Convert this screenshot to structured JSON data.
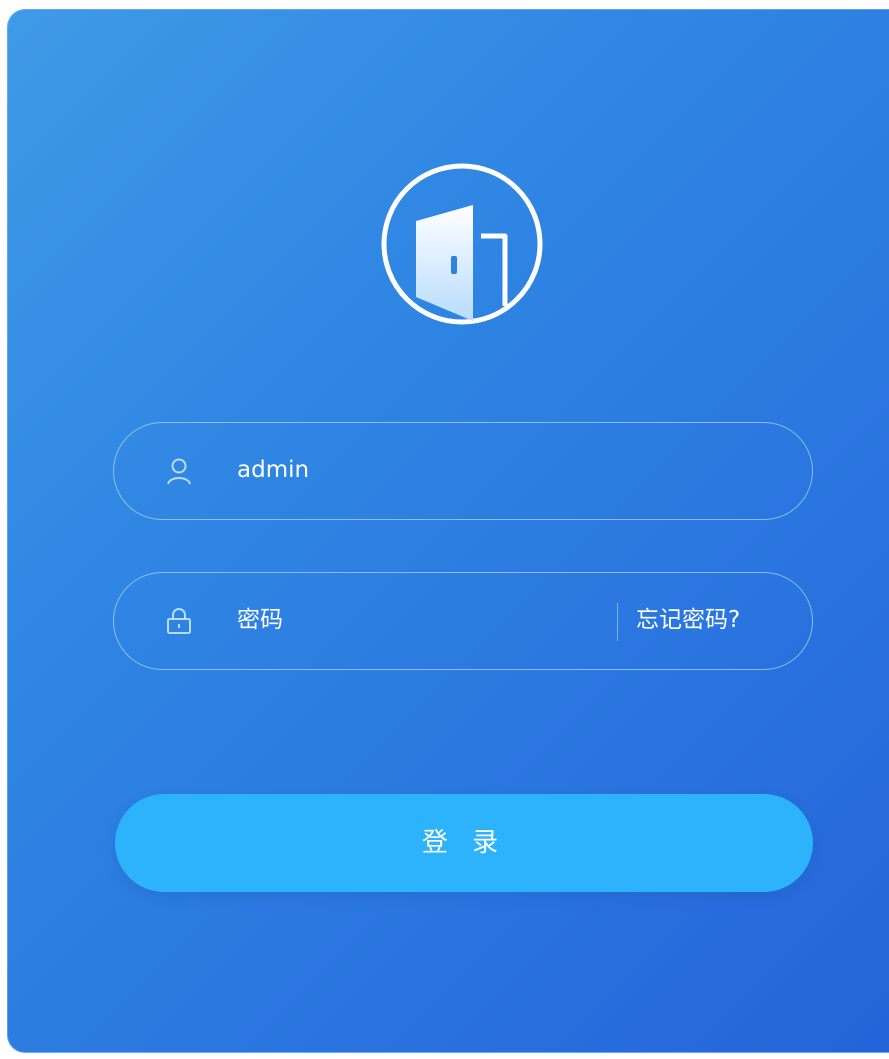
{
  "login": {
    "username": {
      "icon": "user-icon",
      "value": "admin"
    },
    "password": {
      "icon": "lock-icon",
      "placeholder": "密码",
      "forgot_link": "忘记密码?"
    },
    "submit_label": "登 录"
  },
  "logo": {
    "icon": "door-icon"
  },
  "colors": {
    "panel_gradient_start": "#3f9ae7",
    "panel_gradient_end": "#2463d9",
    "button": "#2db3fb",
    "text": "#ffffff"
  }
}
